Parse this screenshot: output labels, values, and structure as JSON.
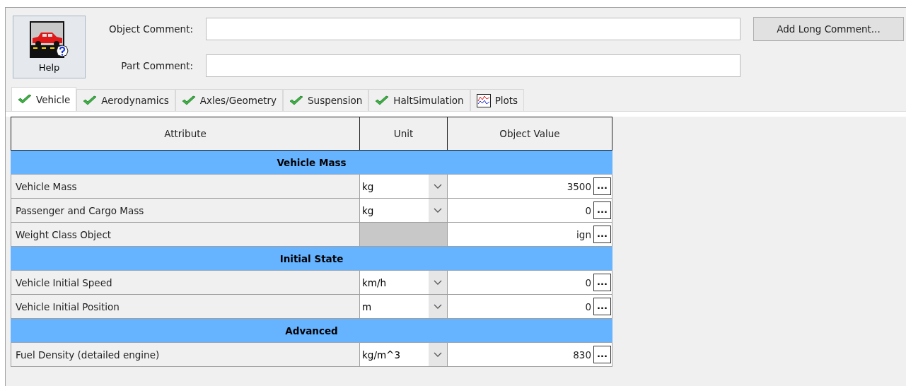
{
  "help_button": {
    "label": "Help"
  },
  "comments": [
    {
      "label": "Object Comment:"
    },
    {
      "label": "Part Comment:"
    }
  ],
  "add_long_comment": {
    "label": "Add Long Comment..."
  },
  "tabs": [
    {
      "label": "Vehicle",
      "kind": "check",
      "selected": true
    },
    {
      "label": "Aerodynamics",
      "kind": "check",
      "selected": false
    },
    {
      "label": "Axles/Geometry",
      "kind": "check",
      "selected": false
    },
    {
      "label": "Suspension",
      "kind": "check",
      "selected": false
    },
    {
      "label": "HaltSimulation",
      "kind": "check",
      "selected": false
    },
    {
      "label": "Plots",
      "kind": "plot",
      "selected": false
    }
  ],
  "table": {
    "columns": [
      "Attribute",
      "Unit",
      "Object Value"
    ],
    "rows": [
      {
        "kind": "group",
        "label": "Vehicle Mass"
      },
      {
        "kind": "attribute",
        "label": "Vehicle Mass",
        "unit": "kg",
        "value": "3500",
        "button": "..."
      },
      {
        "kind": "attribute",
        "label": "Passenger and Cargo Mass",
        "unit": "kg",
        "value": "0",
        "button": "..."
      },
      {
        "kind": "attribute",
        "label": "Weight Class Object",
        "value": "ign",
        "button": "..."
      },
      {
        "kind": "group",
        "label": "Initial State"
      },
      {
        "kind": "attribute",
        "label": "Vehicle Initial Speed",
        "unit": "km/h",
        "value": "0",
        "button": "..."
      },
      {
        "kind": "attribute",
        "label": "Vehicle Initial Position",
        "unit": "m",
        "value": "0",
        "button": "..."
      },
      {
        "kind": "group",
        "label": "Advanced"
      },
      {
        "kind": "attribute",
        "label": "Fuel Density (detailed engine)",
        "unit": "kg/m^3",
        "value": "830",
        "button": "..."
      }
    ]
  }
}
